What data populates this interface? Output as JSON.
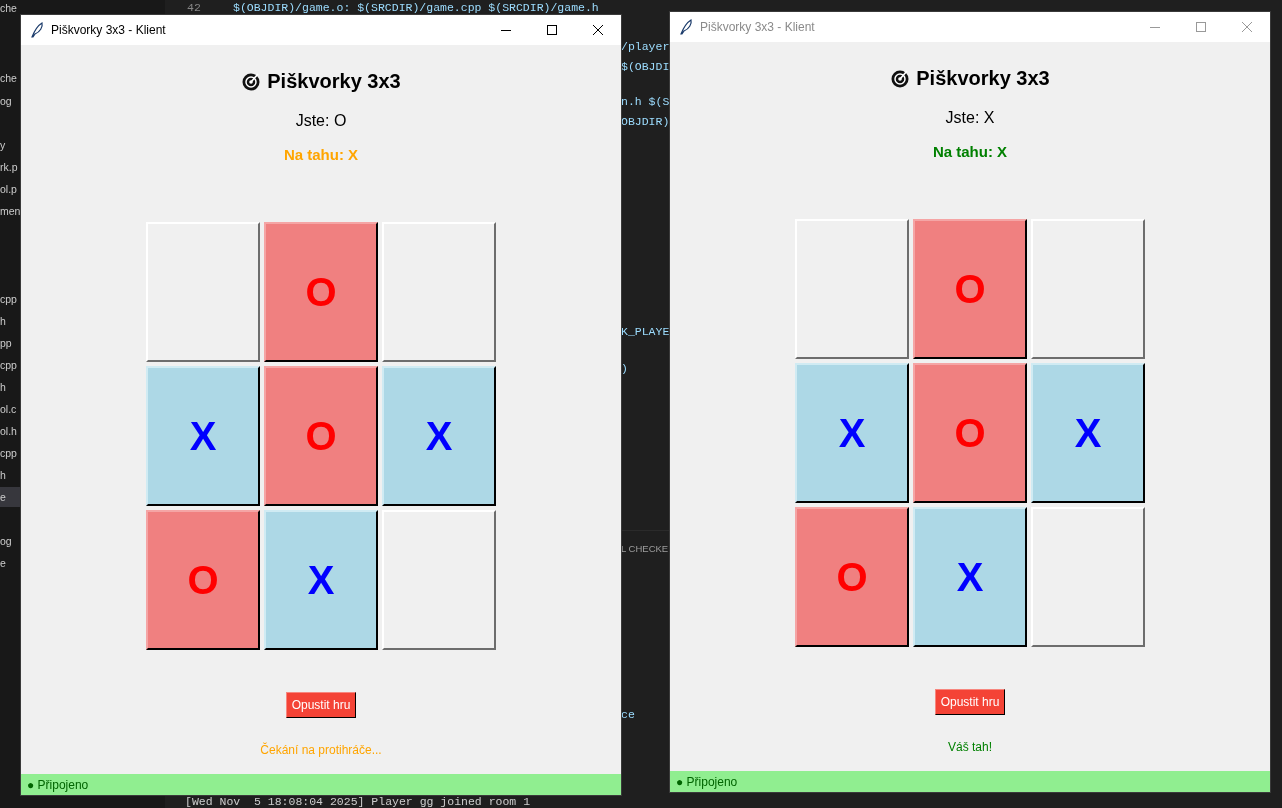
{
  "editor": {
    "explorer_items": [
      {
        "label": "che",
        "selected": false
      },
      {
        "label": "che",
        "selected": false
      },
      {
        "label": "og",
        "selected": false
      },
      {
        "label": "y",
        "selected": false
      },
      {
        "label": "rk.p",
        "selected": false
      },
      {
        "label": "ol.p",
        "selected": false
      },
      {
        "label": "men",
        "selected": false
      },
      {
        "label": "cpp",
        "selected": false
      },
      {
        "label": "h",
        "selected": false
      },
      {
        "label": "pp",
        "selected": false
      },
      {
        "label": "cpp",
        "selected": false
      },
      {
        "label": "h",
        "selected": false
      },
      {
        "label": "ol.c",
        "selected": false
      },
      {
        "label": "ol.h",
        "selected": false
      },
      {
        "label": "cpp",
        "selected": false
      },
      {
        "label": "h",
        "selected": false
      },
      {
        "label": "e",
        "selected": true
      },
      {
        "label": "og",
        "selected": false
      },
      {
        "label": "e",
        "selected": false
      }
    ],
    "line_number": "42",
    "code_fragments": [
      {
        "text": "$(OBJDIR)/game.o: $(SRCDIR)/game.cpp $(SRCDIR)/game.h"
      },
      {
        "text": "/player"
      },
      {
        "text": "$(OBJDI"
      },
      {
        "text": "n.h $(S"
      },
      {
        "text": "OBJDIR)"
      },
      {
        "text": "K_PLAYE"
      },
      {
        "text": ")"
      },
      {
        "text": "L CHECKE"
      },
      {
        "text": "ce"
      }
    ],
    "terminal_log": "[Wed Nov  5 18:08:04 2025] Player gg joined room 1"
  },
  "windows": [
    {
      "title": "Piškvorky 3x3 - Klient",
      "active": true,
      "heading": "Piškvorky 3x3",
      "player": "Jste: O",
      "turn": {
        "text": "Na tahu: X",
        "color": "#ffa500"
      },
      "board": [
        {
          "kind": "empty"
        },
        {
          "kind": "o",
          "label": "O"
        },
        {
          "kind": "empty"
        },
        {
          "kind": "x",
          "label": "X"
        },
        {
          "kind": "o",
          "label": "O"
        },
        {
          "kind": "x",
          "label": "X"
        },
        {
          "kind": "o",
          "label": "O"
        },
        {
          "kind": "x",
          "label": "X"
        },
        {
          "kind": "empty"
        }
      ],
      "leave_button": "Opustit hru",
      "message": {
        "text": "Čekání na protihráče...",
        "color": "#ffa500"
      },
      "status": "● Připojeno"
    },
    {
      "title": "Piškvorky 3x3 - Klient",
      "active": false,
      "heading": "Piškvorky 3x3",
      "player": "Jste: X",
      "turn": {
        "text": "Na tahu: X",
        "color": "#008000"
      },
      "board": [
        {
          "kind": "empty"
        },
        {
          "kind": "o",
          "label": "O"
        },
        {
          "kind": "empty"
        },
        {
          "kind": "x",
          "label": "X"
        },
        {
          "kind": "o",
          "label": "O"
        },
        {
          "kind": "x",
          "label": "X"
        },
        {
          "kind": "o",
          "label": "O"
        },
        {
          "kind": "x",
          "label": "X"
        },
        {
          "kind": "empty"
        }
      ],
      "leave_button": "Opustit hru",
      "message": {
        "text": "Váš tah!",
        "color": "#008000"
      },
      "status": "● Připojeno"
    }
  ]
}
